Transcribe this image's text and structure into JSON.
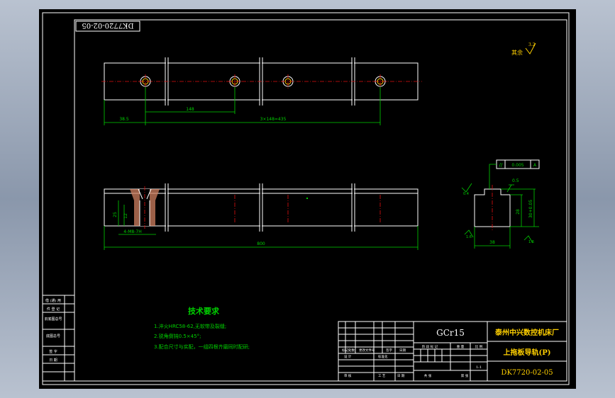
{
  "drawing_number_rotated": "DK7720-02-05",
  "roughness_note": "其余",
  "roughness_value": "3.2",
  "dims": {
    "left_offset": "38.5",
    "pitch": "148",
    "pitch_chain": "3×148=435",
    "overall_length": "800",
    "counterbore": "4-M8-7H",
    "hole_depth_a": "25",
    "hole_depth_b": "12",
    "section_top": "0.5",
    "section_height": "28",
    "section_total": "30+0.05",
    "section_width": "38",
    "roughness_side": "1.6",
    "roughness_bottom": "1.6",
    "roughness_left": "0.4",
    "tolerance_symbol": "//",
    "tolerance_value": "0.005",
    "tolerance_datum": "A"
  },
  "tech": {
    "title": "技术要求",
    "items": [
      "1.淬火HRC58-62,无软带及裂缝;",
      "2.锐角倒钝0.5×45°;",
      "3.配合尺寸与实配，一组四根齐磨同时配研;"
    ]
  },
  "title_block": {
    "material": "GCr15",
    "company": "泰州中兴数控机床厂",
    "part_name": "上拖板导轨(P)",
    "drawing_number": "DK7720-02-05",
    "scale": "1:1"
  },
  "side_labels": [
    "借 (通) 用",
    "件 登 记",
    "旧底图总号",
    "底图总号",
    "签  字",
    "日  期"
  ],
  "grid_labels": [
    "标记",
    "处数",
    "更改文件号",
    "签字",
    "日期",
    "设 计",
    "标准化",
    "审 核",
    "工 艺",
    "日 期"
  ],
  "grid_right_labels": [
    "阶 段 标 记",
    "重 量",
    "比 例",
    "共 张",
    "第 张"
  ]
}
